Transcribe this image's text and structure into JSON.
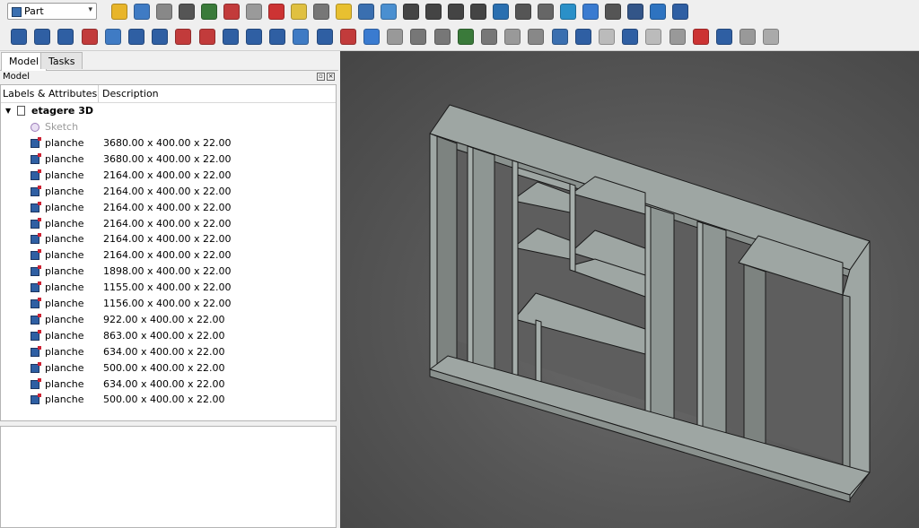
{
  "toolbar": {
    "workbench": "Part"
  },
  "tabs": [
    {
      "label": "Model"
    },
    {
      "label": "Tasks"
    }
  ],
  "model_panel": {
    "title": "Model",
    "columns": {
      "labels": "Labels & Attributes",
      "description": "Description"
    }
  },
  "tree": {
    "root": {
      "label": "etagere 3D"
    },
    "sketch": {
      "label": "Sketch"
    },
    "items": [
      {
        "label": "planche",
        "desc": "3680.00 x 400.00 x 22.00"
      },
      {
        "label": "planche",
        "desc": "3680.00 x 400.00 x 22.00"
      },
      {
        "label": "planche",
        "desc": "2164.00 x 400.00 x 22.00"
      },
      {
        "label": "planche",
        "desc": "2164.00 x 400.00 x 22.00"
      },
      {
        "label": "planche",
        "desc": "2164.00 x 400.00 x 22.00"
      },
      {
        "label": "planche",
        "desc": "2164.00 x 400.00 x 22.00"
      },
      {
        "label": "planche",
        "desc": "2164.00 x 400.00 x 22.00"
      },
      {
        "label": "planche",
        "desc": "2164.00 x 400.00 x 22.00"
      },
      {
        "label": "planche",
        "desc": "1898.00 x 400.00 x 22.00"
      },
      {
        "label": "planche",
        "desc": "1155.00 x 400.00 x 22.00"
      },
      {
        "label": "planche",
        "desc": "1156.00 x 400.00 x 22.00"
      },
      {
        "label": "planche",
        "desc": "922.00 x 400.00 x 22.00"
      },
      {
        "label": "planche",
        "desc": "863.00 x 400.00 x 22.00"
      },
      {
        "label": "planche",
        "desc": "634.00 x 400.00 x 22.00"
      },
      {
        "label": "planche",
        "desc": "500.00 x 400.00 x 22.00"
      },
      {
        "label": "planche",
        "desc": "634.00 x 400.00 x 22.00"
      },
      {
        "label": "planche",
        "desc": "500.00 x 400.00 x 22.00"
      }
    ]
  },
  "colors": {
    "panel_fill": "#9ea6a3",
    "panel_dark": "#7d8380",
    "panel_edge": "#1a1a1a",
    "viewport_bg": "#555555"
  },
  "toolbar_icons": {
    "row1": [
      "new-part-icon",
      "open-icon",
      "import-icon",
      "macro-icon",
      "std-view-icon",
      "refresh-icon",
      "cube-icon",
      "delete-icon",
      "axo-icon",
      "measure-icon",
      "cut-icon",
      "no-icon",
      "fit-icon",
      "mass-icon",
      "mass2-icon",
      "mass3-icon",
      "mass4-icon",
      "checklist-icon",
      "clipboard-icon",
      "clamp-icon",
      "arrow-icon",
      "connect-icon",
      "grid-icon",
      "tip-icon",
      "help-icon",
      "layout-icon"
    ],
    "row2": [
      "box-icon",
      "cylinder-icon",
      "sphere-icon",
      "cone-icon",
      "torus-icon",
      "tube-icon",
      "primitives-icon",
      "builder-icon",
      "sketch-icon",
      "extrude-icon",
      "revolve-icon",
      "mirror-icon",
      "fillet-icon",
      "chamfer-icon",
      "face-icon",
      "ruled-icon",
      "loft-icon",
      "sweep-icon",
      "section-icon",
      "crosssection-icon",
      "offset-icon",
      "thickness-icon",
      "projection-icon",
      "compound-icon",
      "boolean-icon",
      "cut2-icon",
      "fuse-icon",
      "common-icon",
      "union-icon",
      "slice-icon",
      "split-icon",
      "check-icon",
      "defeat-icon"
    ]
  }
}
